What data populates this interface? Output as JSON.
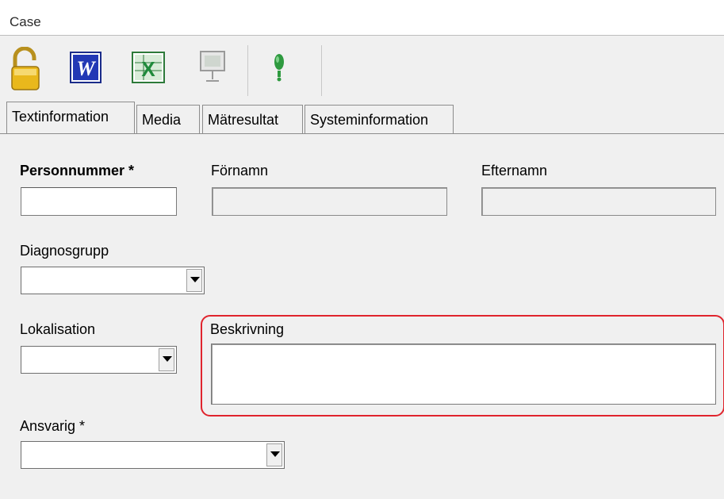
{
  "window": {
    "title": "Case"
  },
  "toolbar": {
    "buttons": [
      {
        "icon": "padlock-icon"
      },
      {
        "icon": "word-icon"
      },
      {
        "icon": "excel-icon"
      },
      {
        "icon": "presentation-icon"
      },
      {
        "icon": "info-pin-icon"
      }
    ]
  },
  "tabs": [
    {
      "label": "Textinformation",
      "active": true
    },
    {
      "label": "Media",
      "active": false
    },
    {
      "label": "Mätresultat",
      "active": false
    },
    {
      "label": "Systeminformation",
      "active": false
    }
  ],
  "form": {
    "personnummer": {
      "label": "Personnummer *",
      "value": ""
    },
    "fornamn": {
      "label": "Förnamn",
      "value": ""
    },
    "efternamn": {
      "label": "Efternamn",
      "value": ""
    },
    "diagnosgrupp": {
      "label": "Diagnosgrupp",
      "value": ""
    },
    "lokalisation": {
      "label": "Lokalisation",
      "value": ""
    },
    "beskrivning": {
      "label": "Beskrivning",
      "value": ""
    },
    "ansvarig": {
      "label": "Ansvarig *",
      "value": ""
    }
  },
  "colors": {
    "highlight": "#e0242d"
  }
}
